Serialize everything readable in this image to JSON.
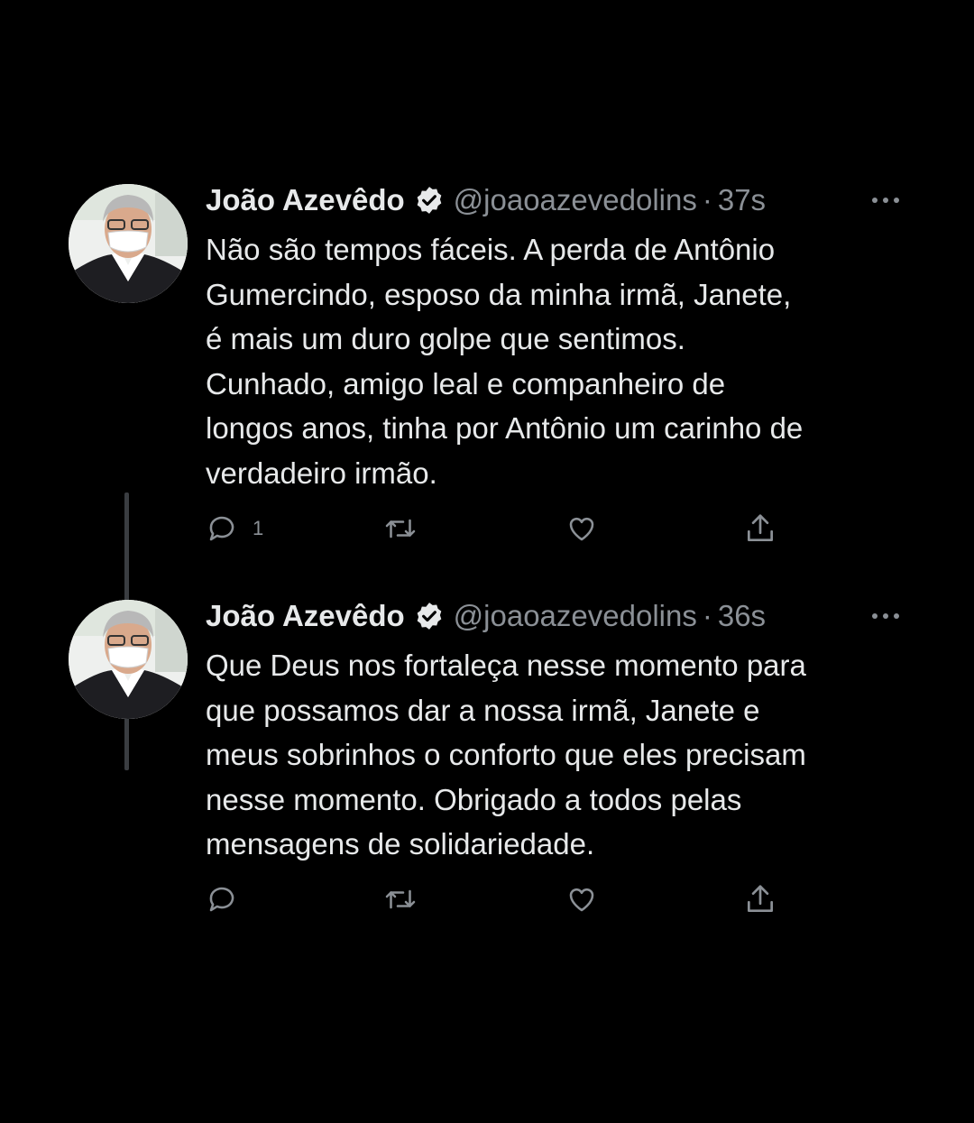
{
  "tweets": [
    {
      "author": {
        "name": "João Azevêdo",
        "handle": "@joaoazevedolins",
        "verified": true
      },
      "timestamp": "37s",
      "text": "Não são tempos fáceis. A perda de Antônio\nGumercindo, esposo da minha irmã, Janete,\né mais um duro golpe que sentimos.\nCunhado, amigo leal e companheiro de\nlongos anos, tinha por Antônio um carinho de\nverdadeiro irmão.",
      "actions": {
        "reply_count": "1",
        "retweet_count": "",
        "like_count": ""
      }
    },
    {
      "author": {
        "name": "João Azevêdo",
        "handle": "@joaoazevedolins",
        "verified": true
      },
      "timestamp": "36s",
      "text": "Que Deus nos fortaleça nesse momento para\nque possamos dar a nossa irmã, Janete e\nmeus sobrinhos o conforto que eles precisam\nnesse momento. Obrigado a todos pelas\nmensagens de solidariedade.",
      "actions": {
        "reply_count": "",
        "retweet_count": "",
        "like_count": ""
      }
    }
  ],
  "icons": {
    "verified": "verified-badge-icon",
    "more": "more-options-icon",
    "reply": "reply-icon",
    "retweet": "retweet-icon",
    "like": "heart-icon",
    "share": "share-icon"
  },
  "colors": {
    "background": "#000000",
    "text_primary": "#e7e9ea",
    "text_secondary": "#8b9096",
    "thread_line": "#3a3d41",
    "verified_badge": "#e7e9ea"
  }
}
